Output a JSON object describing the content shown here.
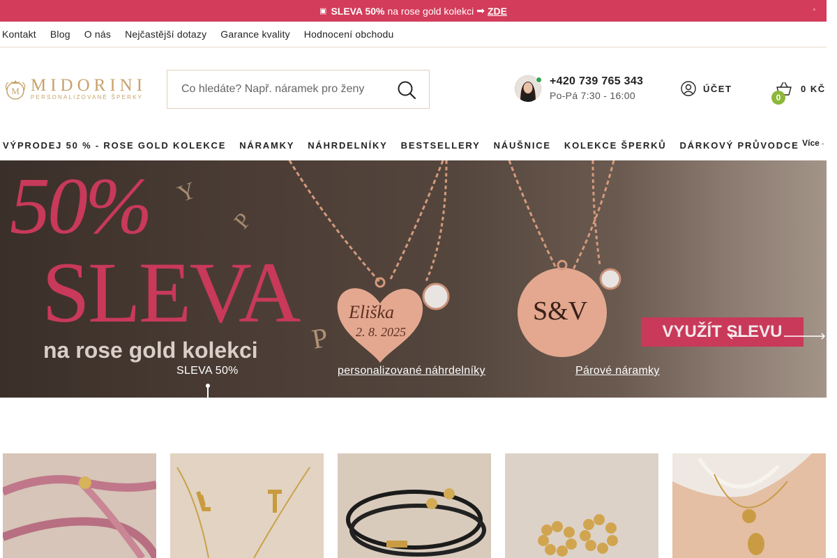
{
  "promo": {
    "icon": "gift-icon",
    "bold": "SLEVA 50%",
    "text": "na rose gold kolekci",
    "arrow": "➡",
    "link": "ZDE"
  },
  "toplinks": [
    "Kontakt",
    "Blog",
    "O nás",
    "Nejčastější dotazy",
    "Garance kvality",
    "Hodnocení obchodu"
  ],
  "logo": {
    "name": "MIDORINI",
    "tagline": "PERSONALIZOVANÉ ŠPERKY",
    "crest_letter": "M"
  },
  "search": {
    "placeholder": "Co hledáte? Např. náramek pro ženy"
  },
  "contact": {
    "phone": "+420 739 765 343",
    "hours": "Po-Pá 7:30 - 16:00",
    "status_color": "#2fa44f"
  },
  "account": {
    "label": "ÚČET"
  },
  "cart": {
    "total": "0 KČ",
    "count": "0",
    "badge_color": "#8cb83a"
  },
  "nav": {
    "items": [
      "VÝPRODEJ 50 % - ROSE GOLD KOLEKCE",
      "NÁRAMKY",
      "NÁHRDELNÍKY",
      "BESTSELLERY",
      "NÁUŠNICE",
      "KOLEKCE ŠPERKŮ",
      "DÁRKOVÝ PRŮVODCE"
    ],
    "more": "Více"
  },
  "hero": {
    "percent": "50%",
    "headline": "SLEVA",
    "subline": "na rose gold kolekci",
    "heart_name": "Eliška",
    "heart_date": "2. 8. 2025",
    "coin_initials": "S&V",
    "cta": "VYUŽÍT SLEVU",
    "tabs": [
      "SLEVA 50%",
      "personalizované náhrdelníky",
      "Párové náramky"
    ],
    "accent": "#c8395a"
  },
  "products": [
    "pink-cord-bracelet",
    "gold-initial-necklace",
    "black-cord-couple-bracelets",
    "gold-bead-earrings",
    "layered-pearl-necklace"
  ]
}
